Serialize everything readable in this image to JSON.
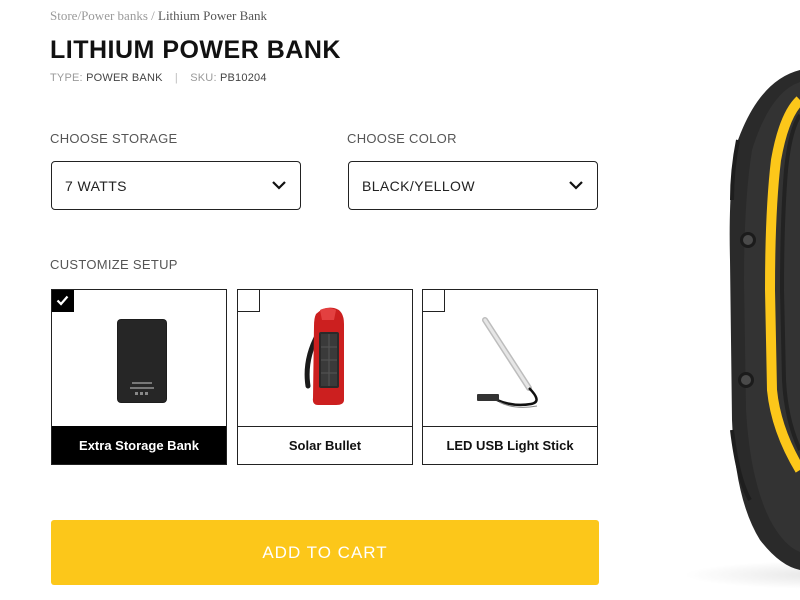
{
  "breadcrumb": {
    "items": [
      "Store",
      "Power banks"
    ],
    "separator": "/",
    "current": "Lithium Power Bank"
  },
  "product": {
    "title": "LITHIUM POWER BANK",
    "type_label": "TYPE:",
    "type_value": "POWER BANK",
    "meta_separator": "|",
    "sku_label": "SKU:",
    "sku_value": "PB10204"
  },
  "storage": {
    "label": "CHOOSE STORAGE",
    "selected": "7 WATTS"
  },
  "color": {
    "label": "CHOOSE COLOR",
    "selected": "BLACK/YELLOW"
  },
  "setup": {
    "label": "CUSTOMIZE SETUP",
    "options": [
      {
        "name": "Extra Storage Bank",
        "selected": true,
        "icon": "power-bank-image"
      },
      {
        "name": "Solar Bullet",
        "selected": false,
        "icon": "solar-bullet-image"
      },
      {
        "name": "LED USB Light Stick",
        "selected": false,
        "icon": "led-light-stick-image"
      }
    ]
  },
  "cart": {
    "label": "ADD TO CART"
  },
  "colors": {
    "accent": "#fcc71a",
    "text": "#111111",
    "muted": "#9a9a9a"
  }
}
